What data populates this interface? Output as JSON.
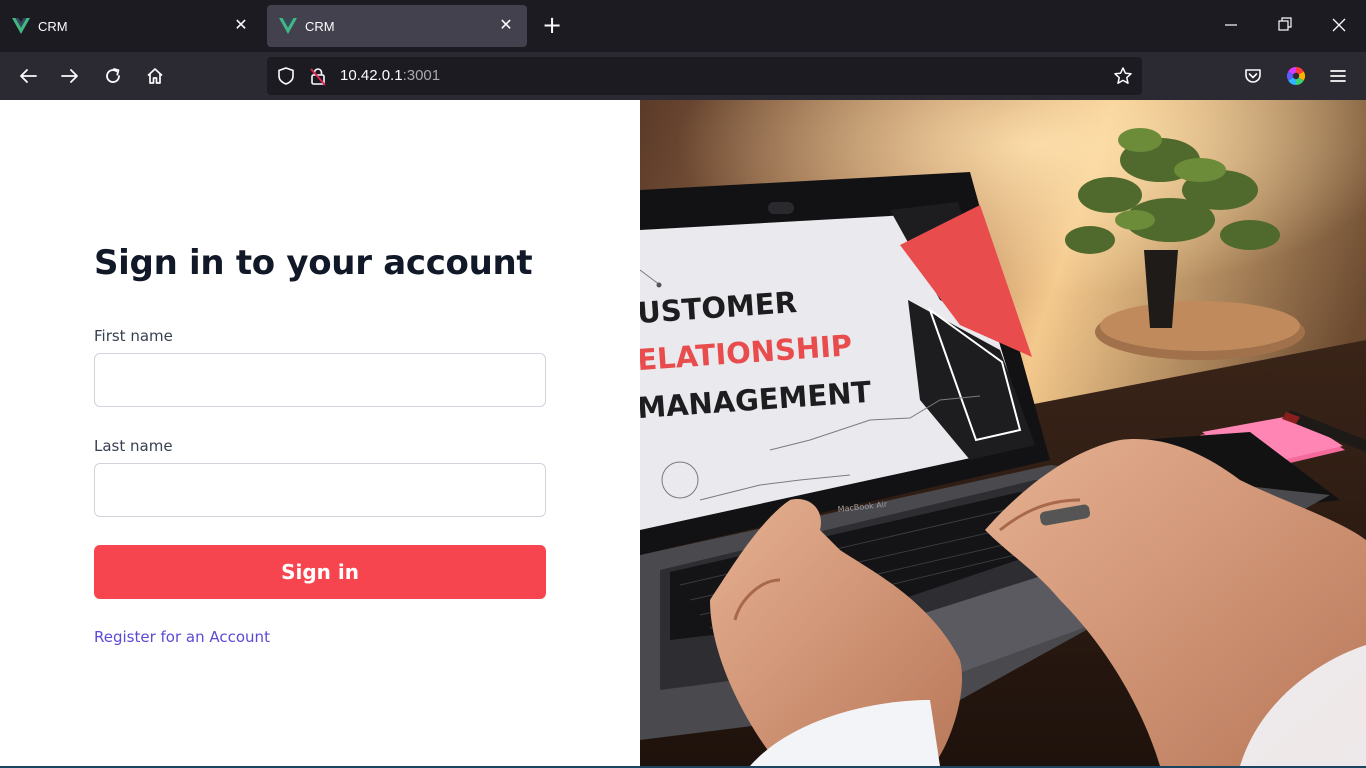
{
  "browser": {
    "tabs": [
      {
        "title": "CRM",
        "active": false
      },
      {
        "title": "CRM",
        "active": true
      }
    ],
    "url_host": "10.42.0.1",
    "url_port": ":3001",
    "icons": {
      "back": "arrow-left-icon",
      "forward": "arrow-right-icon",
      "reload": "reload-icon",
      "home": "home-icon",
      "shield": "shield-icon",
      "insecure": "insecure-lock-icon",
      "bookmark": "star-icon",
      "pocket": "pocket-icon",
      "extension": "color-wheel-icon",
      "menu": "hamburger-menu-icon",
      "tab_close": "close-icon",
      "new_tab": "plus-icon",
      "minimize": "minimize-icon",
      "restore": "restore-icon",
      "close_window": "close-icon"
    }
  },
  "login": {
    "title": "Sign in to your account",
    "first_name_label": "First name",
    "first_name_value": "",
    "last_name_label": "Last name",
    "last_name_value": "",
    "sign_in_label": "Sign in",
    "register_link": "Register for an Account"
  },
  "hero": {
    "screen_line1": "USTOMER",
    "screen_line2": "ELATIONSHIP",
    "screen_line3": "MANAGEMENT",
    "laptop_brand": "MacBook Air"
  },
  "colors": {
    "accent": "#f7454f",
    "link": "#5b4ad6",
    "chrome_dark": "#1c1b22",
    "chrome_toolbar": "#2b2a33",
    "vue_green": "#41b883"
  }
}
